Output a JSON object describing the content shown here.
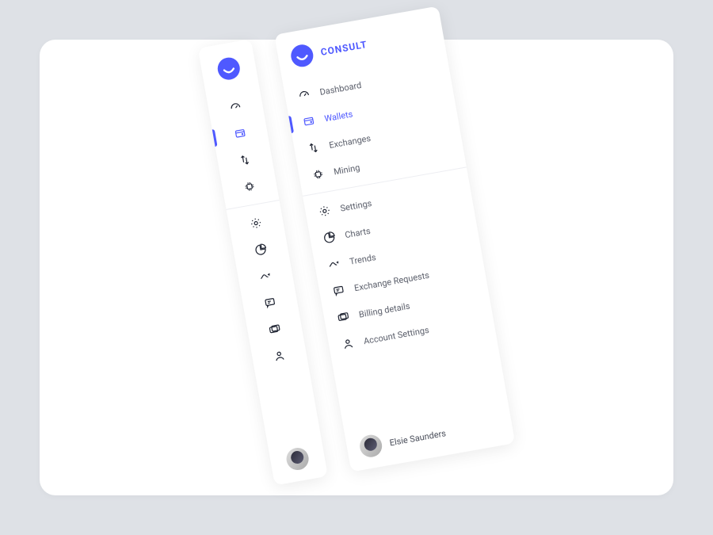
{
  "brand": {
    "name": "CONSULT"
  },
  "activeIndex": 1,
  "sections": [
    {
      "id": "primary",
      "items": [
        {
          "label": "Dashboard",
          "icon": "gauge-icon"
        },
        {
          "label": "Wallets",
          "icon": "wallet-icon"
        },
        {
          "label": "Exchanges",
          "icon": "transfer-icon"
        },
        {
          "label": "Mining",
          "icon": "chip-icon"
        }
      ]
    },
    {
      "id": "secondary",
      "items": [
        {
          "label": "Settings",
          "icon": "gear-icon"
        },
        {
          "label": "Charts",
          "icon": "pie-icon"
        },
        {
          "label": "Trends",
          "icon": "trend-icon"
        },
        {
          "label": "Exchange Requests",
          "icon": "chat-icon"
        },
        {
          "label": "Billing details",
          "icon": "card-icon"
        },
        {
          "label": "Account Settings",
          "icon": "user-icon"
        }
      ]
    }
  ],
  "user": {
    "name": "Elsie Saunders"
  }
}
